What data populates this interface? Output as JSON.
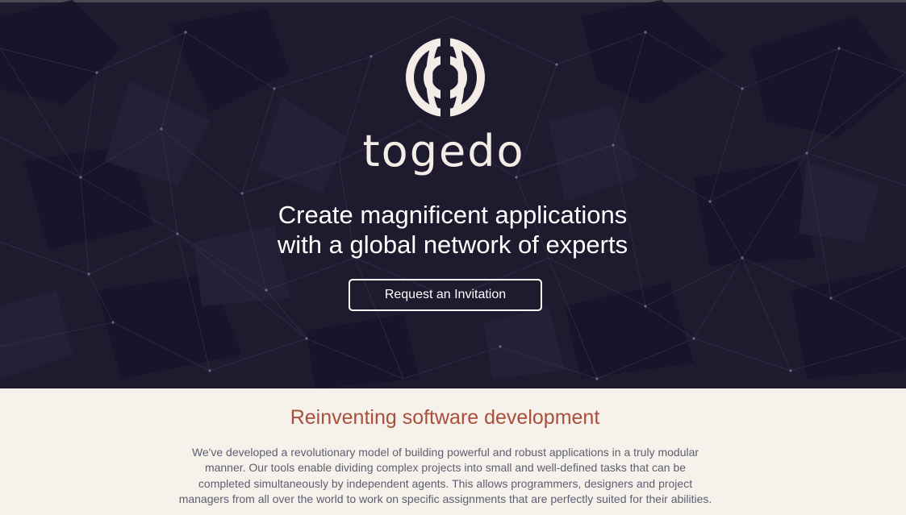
{
  "hero": {
    "brand_name": "togedo",
    "headline_line1": "Create magnificent applications",
    "headline_line2": "with a global network of experts",
    "cta_label": "Request an Invitation",
    "logo_icon": "togedo-logo-icon"
  },
  "about": {
    "title": "Reinventing software development",
    "body": "We've developed a revolutionary model of building powerful and robust applications in a truly modular manner. Our tools enable dividing complex projects into small and well-defined tasks that can be completed simultaneously by independent agents. This allows programmers, designers and project managers from all over the world to work on specific assignments that are perfectly suited for their abilities."
  },
  "colors": {
    "hero_background": "#1e1b2e",
    "logo_color": "#f4ece6",
    "about_background": "#f6f1eb",
    "about_title": "#a94f3a",
    "about_text": "#5d5f70"
  }
}
